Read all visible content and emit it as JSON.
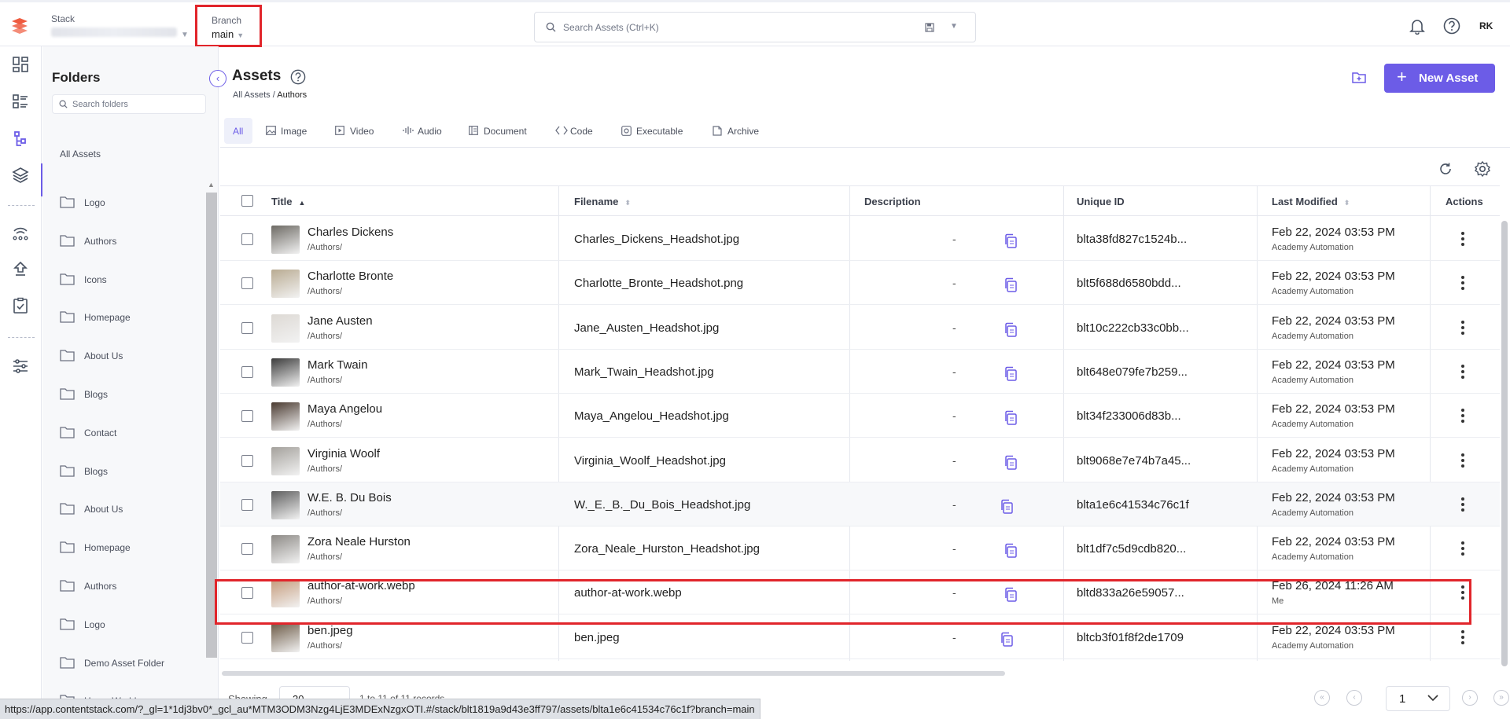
{
  "topbar": {
    "stack_label": "Stack",
    "branch_label": "Branch",
    "branch_value": "main",
    "search_placeholder": "Search Assets (Ctrl+K)",
    "user_initials": "RK"
  },
  "folders_panel": {
    "title": "Folders",
    "search_placeholder": "Search folders",
    "all_assets": "All Assets",
    "items": [
      "Logo",
      "Authors",
      "Icons",
      "Homepage",
      "About Us",
      "Blogs",
      "Contact",
      "Blogs",
      "About Us",
      "Homepage",
      "Authors",
      "Logo",
      "Demo Asset Folder",
      "Home Worlds"
    ]
  },
  "main": {
    "title": "Assets",
    "breadcrumb_root": "All Assets",
    "breadcrumb_sep": " / ",
    "breadcrumb_current": "Authors",
    "new_asset_label": "New Asset"
  },
  "tabs": [
    {
      "label": "All",
      "icon": "all"
    },
    {
      "label": "Image",
      "icon": "image-icon"
    },
    {
      "label": "Video",
      "icon": "video-icon"
    },
    {
      "label": "Audio",
      "icon": "audio-icon"
    },
    {
      "label": "Document",
      "icon": "document-icon"
    },
    {
      "label": "Code",
      "icon": "code-icon"
    },
    {
      "label": "Executable",
      "icon": "executable-icon"
    },
    {
      "label": "Archive",
      "icon": "archive-icon"
    }
  ],
  "table": {
    "columns": {
      "title": "Title",
      "filename": "Filename",
      "description": "Description",
      "unique_id": "Unique ID",
      "last_modified": "Last Modified",
      "actions": "Actions"
    },
    "rows": [
      {
        "title": "Charles Dickens",
        "path": "/Authors/",
        "filename": "Charles_Dickens_Headshot.jpg",
        "description": "-",
        "uid": "blta38fd827c1524b...",
        "modified": "Feb 22, 2024 03:53 PM",
        "by": "Academy Automation"
      },
      {
        "title": "Charlotte Bronte",
        "path": "/Authors/",
        "filename": "Charlotte_Bronte_Headshot.png",
        "description": "-",
        "uid": "blt5f688d6580bdd...",
        "modified": "Feb 22, 2024 03:53 PM",
        "by": "Academy Automation"
      },
      {
        "title": "Jane Austen",
        "path": "/Authors/",
        "filename": "Jane_Austen_Headshot.jpg",
        "description": "-",
        "uid": "blt10c222cb33c0bb...",
        "modified": "Feb 22, 2024 03:53 PM",
        "by": "Academy Automation"
      },
      {
        "title": "Mark Twain",
        "path": "/Authors/",
        "filename": "Mark_Twain_Headshot.jpg",
        "description": "-",
        "uid": "blt648e079fe7b259...",
        "modified": "Feb 22, 2024 03:53 PM",
        "by": "Academy Automation"
      },
      {
        "title": "Maya Angelou",
        "path": "/Authors/",
        "filename": "Maya_Angelou_Headshot.jpg",
        "description": "-",
        "uid": "blt34f233006d83b...",
        "modified": "Feb 22, 2024 03:53 PM",
        "by": "Academy Automation"
      },
      {
        "title": "Virginia Woolf",
        "path": "/Authors/",
        "filename": "Virginia_Woolf_Headshot.jpg",
        "description": "-",
        "uid": "blt9068e7e74b7a45...",
        "modified": "Feb 22, 2024 03:53 PM",
        "by": "Academy Automation"
      },
      {
        "title": "W.E. B. Du Bois",
        "path": "/Authors/",
        "filename": "W._E._B._Du_Bois_Headshot.jpg",
        "description": "-",
        "uid": "blta1e6c41534c76c1f",
        "modified": "Feb 22, 2024 03:53 PM",
        "by": "Academy Automation"
      },
      {
        "title": "Zora Neale Hurston",
        "path": "/Authors/",
        "filename": "Zora_Neale_Hurston_Headshot.jpg",
        "description": "-",
        "uid": "blt1df7c5d9cdb820...",
        "modified": "Feb 22, 2024 03:53 PM",
        "by": "Academy Automation"
      },
      {
        "title": "author-at-work.webp",
        "path": "/Authors/",
        "filename": "author-at-work.webp",
        "description": "-",
        "uid": "bltd833a26e59057...",
        "modified": "Feb 26, 2024 11:26 AM",
        "by": "Me"
      },
      {
        "title": "ben.jpeg",
        "path": "/Authors/",
        "filename": "ben.jpeg",
        "description": "-",
        "uid": "bltcb3f01f8f2de1709",
        "modified": "Feb 22, 2024 03:53 PM",
        "by": "Academy Automation"
      }
    ]
  },
  "footer": {
    "showing_label": "Showing",
    "page_size": "30",
    "records": "1 to 11 of 11 records",
    "page": "1"
  },
  "status_url": "https://app.contentstack.com/?_gl=1*1dj3bv0*_gcl_au*MTM3ODM3Nzg4LjE3MDExNzgxOTI.#/stack/blt1819a9d43e3ff797/assets/blta1e6c41534c76c1f?branch=main",
  "colors": {
    "accent": "#6c5ce7",
    "highlight_box": "#e1252b",
    "logo": "#ef5b3f"
  }
}
